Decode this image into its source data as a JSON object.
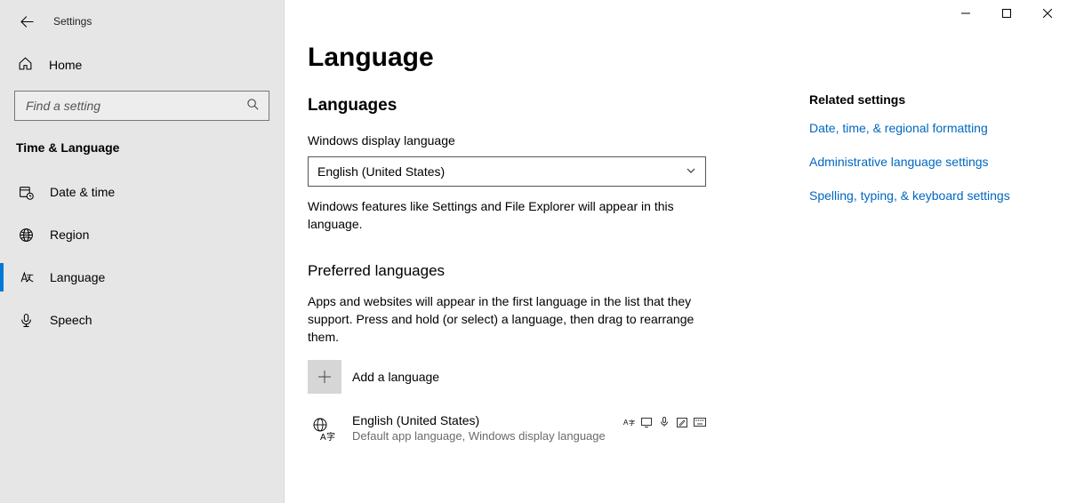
{
  "window": {
    "title": "Settings"
  },
  "sidebar": {
    "home_label": "Home",
    "search_placeholder": "Find a setting",
    "section_header": "Time & Language",
    "items": [
      {
        "label": "Date & time"
      },
      {
        "label": "Region"
      },
      {
        "label": "Language"
      },
      {
        "label": "Speech"
      }
    ]
  },
  "page": {
    "title": "Language",
    "languages_section": "Languages",
    "display_lang_label": "Windows display language",
    "display_lang_value": "English (United States)",
    "display_help": "Windows features like Settings and File Explorer will appear in this language.",
    "preferred_section": "Preferred languages",
    "preferred_help": "Apps and websites will appear in the first language in the list that they support. Press and hold (or select) a language, then drag to rearrange them.",
    "add_label": "Add a language",
    "lang_entry": {
      "name": "English (United States)",
      "sub": "Default app language, Windows display language"
    }
  },
  "related": {
    "header": "Related settings",
    "links": [
      "Date, time, & regional formatting",
      "Administrative language settings",
      "Spelling, typing, & keyboard settings"
    ]
  }
}
